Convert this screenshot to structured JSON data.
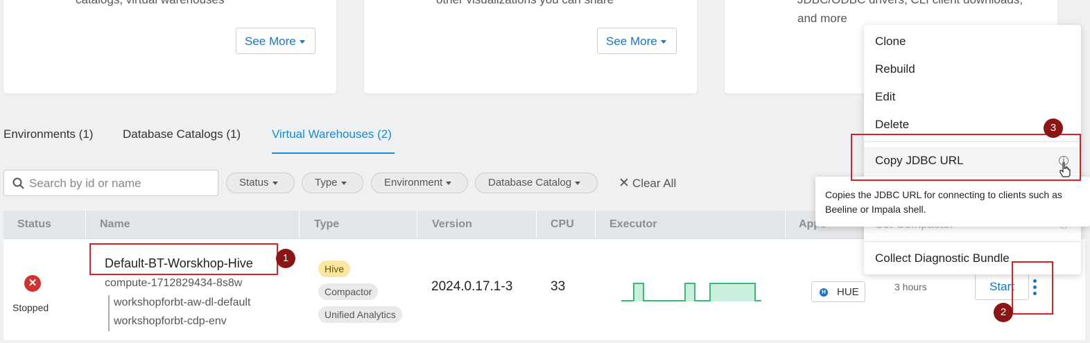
{
  "cards": [
    {
      "description": "catalogs, virtual warehouses",
      "button": "See More"
    },
    {
      "description": "other visualizations you can share",
      "button": "See More"
    },
    {
      "description": "JDBC/ODBC drivers, CLI client downloads, and more"
    }
  ],
  "tabs": [
    {
      "label": "Environments (1)",
      "active": false
    },
    {
      "label": "Database Catalogs (1)",
      "active": false
    },
    {
      "label": "Virtual Warehouses (2)",
      "active": true
    }
  ],
  "search": {
    "placeholder": "Search by id or name"
  },
  "filters": [
    "Status",
    "Type",
    "Environment",
    "Database Catalog"
  ],
  "clear_all": "Clear All",
  "table": {
    "headers": [
      "Status",
      "Name",
      "Type",
      "Version",
      "CPU",
      "Executor",
      "Apps"
    ],
    "row": {
      "status": "Stopped",
      "name": "Default-BT-Worskhop-Hive",
      "id": "compute-1712829434-8s8w",
      "database_catalog": "workshopforbt-aw-dl-default",
      "environment": "workshopforbt-cdp-env",
      "tags": [
        "Hive",
        "Compactor",
        "Unified Analytics"
      ],
      "version": "2024.0.17.1-3",
      "cpu": "33",
      "app": "HUE",
      "uptime": "3 hours",
      "action": "Start"
    }
  },
  "menu": {
    "items": [
      "Clone",
      "Rebuild",
      "Edit",
      "Delete",
      "Copy JDBC URL",
      "Collect Diagnostic Bundle"
    ],
    "faded_item": "Set Compactor"
  },
  "tooltip": "Copies the JDBC URL for connecting to clients such as Beeline or Impala shell.",
  "annotations": [
    "1",
    "2",
    "3"
  ],
  "colors": {
    "accent": "#1a8ad4",
    "link": "#1a73c8",
    "stopped": "#d0322d",
    "annotation": "#e11d1d",
    "annotation_badge": "#8b1414",
    "tag_hive": "#fbe7a2",
    "executor_chart": "#3cb878"
  }
}
